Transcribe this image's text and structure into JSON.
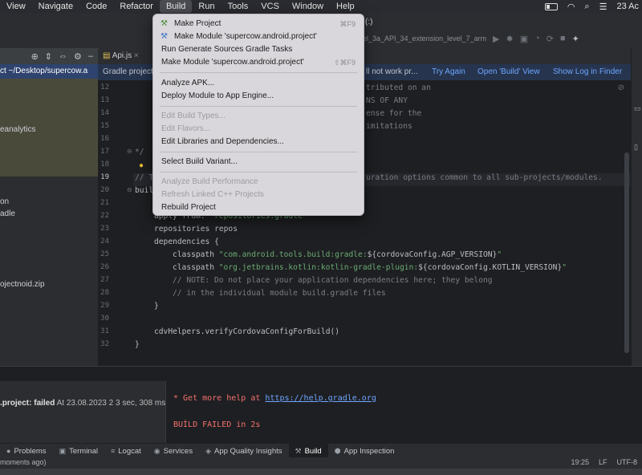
{
  "menubar": {
    "items": [
      "View",
      "Navigate",
      "Code",
      "Refactor",
      "Build",
      "Run",
      "Tools",
      "VCS",
      "Window",
      "Help"
    ],
    "active": "Build",
    "clock": "23 Ac"
  },
  "toolbar": {
    "run_config": "el_3a_API_34_extension_level_7_arm",
    "title_fragment": "(:)"
  },
  "right_panel": {
    "label": "De"
  },
  "project_panel": {
    "root_label": "ct ~/Desktop/supercow.a",
    "items": [
      "eanalytics",
      "on",
      "adle",
      "ojectnoid.zip"
    ]
  },
  "editor_tabs": {
    "active_tab": "Api.js"
  },
  "banner": {
    "prefix": "Gradle project",
    "suffix": "ll not work pr...",
    "try_again": "Try Again",
    "open_build_view": "Open 'Build' View",
    "show_log": "Show Log in Finder"
  },
  "editor": {
    "line_numbers": [
      "12",
      "13",
      "14",
      "15",
      "16",
      "17",
      "18",
      "19",
      "20",
      "21",
      "22",
      "23",
      "24",
      "25",
      "26",
      "27",
      "28",
      "29",
      "30",
      "31",
      "32"
    ],
    "fragments": {
      "l12": "tributed on an",
      "l13": "NS OF ANY",
      "l14": "ense for the",
      "l15": "imitations",
      "l17": "*/",
      "l19a": "// T",
      "l19b": "uration options common to all sub-projects/modules.",
      "l20": "buil",
      "l22a": "apply from: ",
      "l22b": "'repositories.gradle'",
      "l23": "repositories repos",
      "l24": "dependencies {",
      "l25a": "classpath ",
      "l25b": "\"com.android.tools.build:gradle:",
      "l25c": "${cordovaConfig.AGP_VERSION}",
      "l25d": "\"",
      "l26a": "classpath ",
      "l26b": "\"org.jetbrains.kotlin:kotlin-gradle-plugin:",
      "l26c": "${cordovaConfig.KOTLIN_VERSION}",
      "l26d": "\"",
      "l27": "// NOTE: Do not place your application dependencies here; they belong",
      "l28": "// in the individual module build.gradle files",
      "l29": "}",
      "l31": "cdvHelpers.verifyCordovaConfigForBuild()",
      "l32": "}"
    }
  },
  "build_menu": {
    "items": [
      {
        "label": "Make Project",
        "shortcut": "⌘F9",
        "icon": "hammer-icon",
        "disabled": false
      },
      {
        "label": "Make Module 'supercow.android.project'",
        "shortcut": "",
        "icon": "hammer-module-icon",
        "disabled": false
      },
      {
        "label": "Run Generate Sources Gradle Tasks",
        "shortcut": "",
        "disabled": false
      },
      {
        "label": "Make Module 'supercow.android.project'",
        "shortcut": "⇧⌘F9",
        "disabled": false
      },
      {
        "label": "Analyze APK...",
        "shortcut": "",
        "disabled": false
      },
      {
        "label": "Deploy Module to App Engine...",
        "shortcut": "",
        "disabled": false
      },
      {
        "label": "Edit Build Types...",
        "shortcut": "",
        "disabled": true
      },
      {
        "label": "Edit Flavors...",
        "shortcut": "",
        "disabled": true
      },
      {
        "label": "Edit Libraries and Dependencies...",
        "shortcut": "",
        "disabled": false
      },
      {
        "label": "Select Build Variant...",
        "shortcut": "",
        "disabled": false
      },
      {
        "label": "Analyze Build Performance",
        "shortcut": "",
        "disabled": true
      },
      {
        "label": "Refresh Linked C++ Projects",
        "shortcut": "",
        "disabled": true
      },
      {
        "label": "Rebuild Project",
        "shortcut": "",
        "disabled": false
      }
    ]
  },
  "build_panel": {
    "result_name": ".project:",
    "result_status": "failed",
    "result_time": "At 23.08.2023 2 3 sec, 308 ms",
    "help_prefix": "* Get more help at ",
    "help_url": "https://help.gradle.org",
    "failed_text": "BUİLD FAILED in 2s"
  },
  "bottom_tabs": [
    "Problems",
    "Terminal",
    "Logcat",
    "Services",
    "App Quality Insights",
    "Build",
    "App Inspection"
  ],
  "bottom_active": "Build",
  "status_bar": {
    "left": "moments ago)",
    "position": "19:25",
    "line_sep": "LF",
    "encoding": "UTF-8"
  }
}
